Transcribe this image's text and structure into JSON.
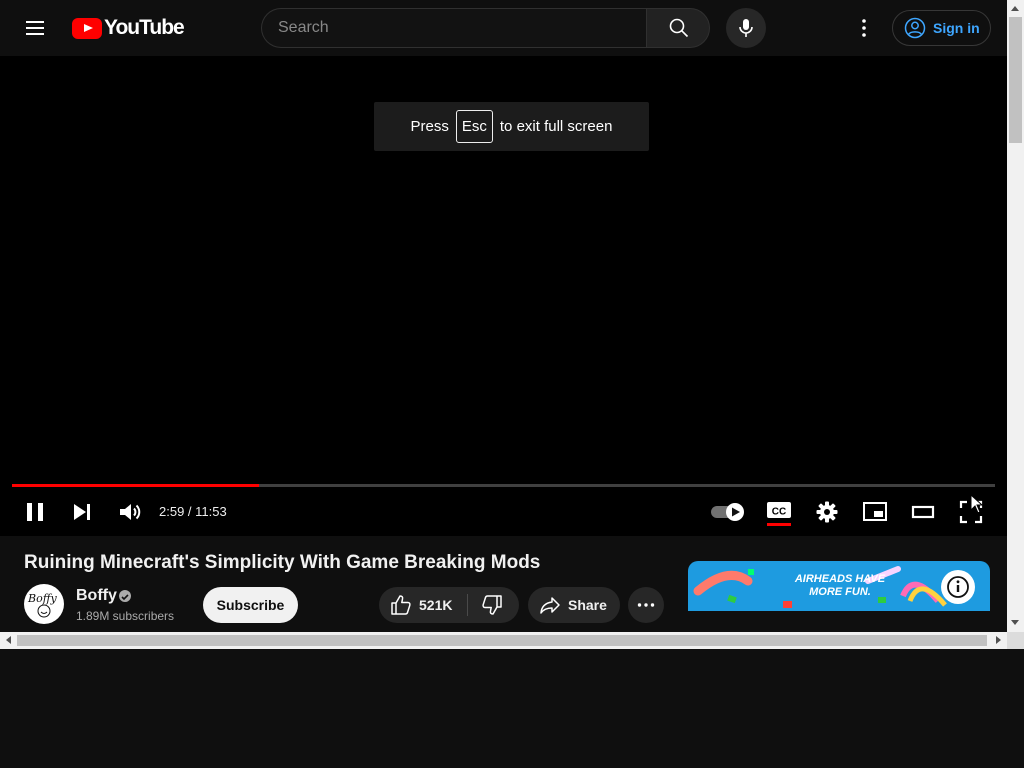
{
  "header": {
    "logo_text": "YouTube",
    "search_placeholder": "Search",
    "signin_label": "Sign in",
    "accent": "#ff0000",
    "signin_color": "#3ea6ff"
  },
  "player": {
    "toast": {
      "prefix": "Press",
      "key": "Esc",
      "suffix": "to exit full screen"
    },
    "time_display": "2:59 / 11:53",
    "progress_fraction": 0.251,
    "state": "playing",
    "icons": [
      "pause-icon",
      "next-icon",
      "volume-icon",
      "autoplay-toggle-icon",
      "captions-icon",
      "settings-gear-icon",
      "miniplayer-icon",
      "theater-mode-icon",
      "fullscreen-icon"
    ]
  },
  "video": {
    "title": "Ruining Minecraft's Simplicity With Game Breaking Mods",
    "channel_name": "Boffy",
    "subscribers": "1.89M subscribers",
    "subscribe_label": "Subscribe",
    "like_count": "521K",
    "share_label": "Share"
  },
  "ad": {
    "text": "AIRHEADS HAVE MORE FUN."
  }
}
